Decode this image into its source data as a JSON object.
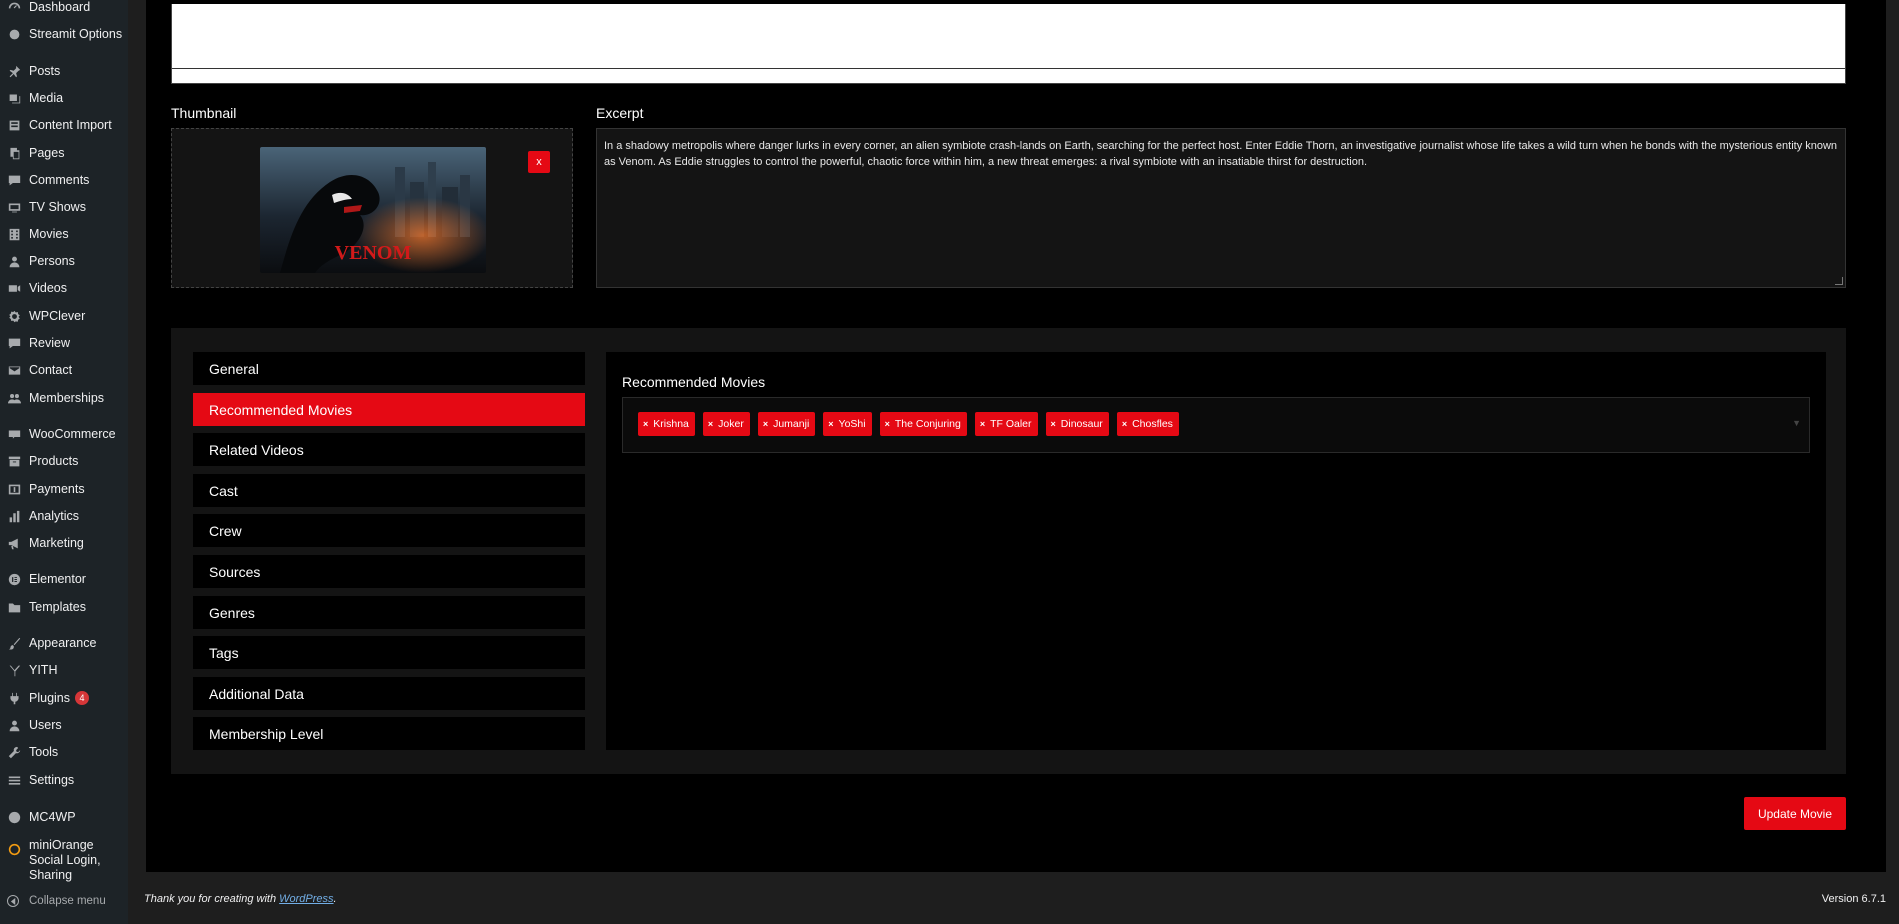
{
  "sidebar": {
    "items": [
      {
        "label": "Dashboard",
        "icon": "dashboard-icon"
      },
      {
        "label": "Streamit Options",
        "icon": "streamit-icon"
      },
      {
        "label": "Posts",
        "icon": "pin-icon"
      },
      {
        "label": "Media",
        "icon": "media-icon"
      },
      {
        "label": "Content Import",
        "icon": "import-icon"
      },
      {
        "label": "Pages",
        "icon": "pages-icon"
      },
      {
        "label": "Comments",
        "icon": "comments-icon"
      },
      {
        "label": "TV Shows",
        "icon": "tv-icon"
      },
      {
        "label": "Movies",
        "icon": "movies-icon"
      },
      {
        "label": "Persons",
        "icon": "person-icon"
      },
      {
        "label": "Videos",
        "icon": "video-icon"
      },
      {
        "label": "WPClever",
        "icon": "gear-icon"
      },
      {
        "label": "Review",
        "icon": "review-icon"
      },
      {
        "label": "Contact",
        "icon": "mail-icon"
      },
      {
        "label": "Memberships",
        "icon": "groups-icon"
      },
      {
        "label": "WooCommerce",
        "icon": "woo-icon"
      },
      {
        "label": "Products",
        "icon": "archive-icon"
      },
      {
        "label": "Payments",
        "icon": "dollar-icon"
      },
      {
        "label": "Analytics",
        "icon": "bar-chart-icon"
      },
      {
        "label": "Marketing",
        "icon": "megaphone-icon"
      },
      {
        "label": "Elementor",
        "icon": "elementor-icon"
      },
      {
        "label": "Templates",
        "icon": "folder-icon"
      },
      {
        "label": "Appearance",
        "icon": "brush-icon"
      },
      {
        "label": "YITH",
        "icon": "yith-icon"
      },
      {
        "label": "Plugins",
        "icon": "plugin-icon",
        "badge": "4"
      },
      {
        "label": "Users",
        "icon": "users-icon"
      },
      {
        "label": "Tools",
        "icon": "wrench-icon"
      },
      {
        "label": "Settings",
        "icon": "settings-icon"
      },
      {
        "label": "MC4WP",
        "icon": "mc4wp-icon"
      },
      {
        "label": "miniOrange Social Login, Sharing",
        "icon": "miniorange-icon"
      }
    ],
    "collapse_label": "Collapse menu"
  },
  "thumbnail": {
    "label": "Thumbnail",
    "image_title": "VENOM",
    "remove_label": "x"
  },
  "excerpt": {
    "label": "Excerpt",
    "text": "In a shadowy metropolis where danger lurks in every corner, an alien symbiote crash-lands on Earth, searching for the perfect host. Enter Eddie Thorn, an investigative journalist whose life takes a wild turn when he bonds with the mysterious entity known as Venom. As Eddie struggles to control the powerful, chaotic force within him, a new threat emerges: a rival symbiote with an insatiable thirst for destruction."
  },
  "tabs": [
    {
      "label": "General",
      "active": false
    },
    {
      "label": "Recommended Movies",
      "active": true
    },
    {
      "label": "Related Videos",
      "active": false
    },
    {
      "label": "Cast",
      "active": false
    },
    {
      "label": "Crew",
      "active": false
    },
    {
      "label": "Sources",
      "active": false
    },
    {
      "label": "Genres",
      "active": false
    },
    {
      "label": "Tags",
      "active": false
    },
    {
      "label": "Additional Data",
      "active": false
    },
    {
      "label": "Membership Level",
      "active": false
    }
  ],
  "recommended": {
    "title": "Recommended Movies",
    "selected": [
      "Krishna",
      "Joker",
      "Jumanji",
      "YoShi",
      "The Conjuring",
      "TF Oaler",
      "Dinosaur",
      "Chosfles"
    ],
    "remove_glyph": "×"
  },
  "actions": {
    "update_label": "Update Movie"
  },
  "footer": {
    "thanks_prefix": "Thank you for creating with ",
    "wp_link": "WordPress",
    "thanks_suffix": ".",
    "version": "Version 6.7.1"
  },
  "colors": {
    "accent": "#e50914",
    "sidebar_bg": "#1d2327",
    "panel_bg": "#141414",
    "main_bg": "#000000"
  }
}
